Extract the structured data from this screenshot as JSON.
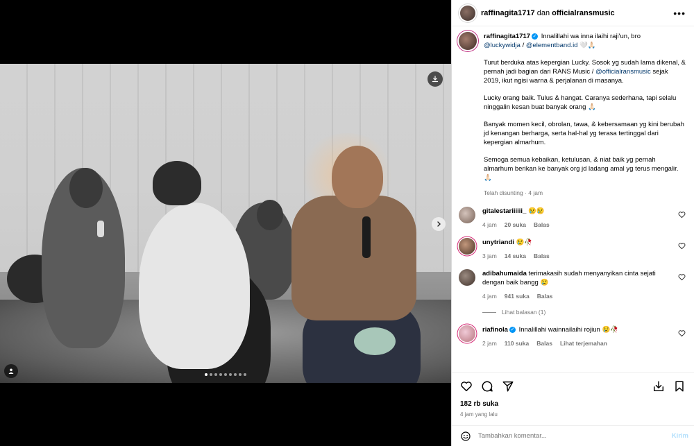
{
  "header": {
    "user1": "raffinagita1717",
    "conj": "dan",
    "user2": "officialransmusic",
    "more": "•••"
  },
  "caption": {
    "username": "raffinagita1717",
    "line1": "Innalillahi wa inna ilaihi raji'un, bro",
    "mention1": "@luckywidja",
    "sep": " / ",
    "mention2": "@elementband.id",
    "line1_end": " 🤍🙏🏻",
    "p1a": "Turut berduka atas kepergian Lucky. Sosok yg sudah lama dikenal, & pernah jadi bagian dari RANS Music /",
    "p1mention": "@officialransmusic",
    "p1b": " sejak 2019, ikut ngisi warna & perjalanan di masanya.",
    "p2": "Lucky orang baik. Tulus & hangat. Caranya sederhana, tapi selalu ninggalin kesan buat banyak orang 🙏🏻",
    "p3": "Banyak momen kecil, obrolan, tawa, & kebersamaan yg kini berubah jd kenangan berharga, serta hal-hal yg terasa tertinggal dari kepergian almarhum.",
    "p4": "Semoga semua kebaikan, ketulusan, & niat baik yg pernah almarhum berikan ke banyak org jd ladang amal yg terus mengalir. 🙏🏻",
    "meta": "Telah disunting · 4 jam"
  },
  "comments": [
    {
      "username": "gitalestariiiiii_",
      "text": "😢😢",
      "time": "4 jam",
      "likes": "20 suka",
      "reply": "Balas",
      "verified": false
    },
    {
      "username": "unytriandi",
      "text": "😢🥀",
      "time": "3 jam",
      "likes": "14 suka",
      "reply": "Balas",
      "verified": false
    },
    {
      "username": "adibahumaida",
      "text": "terimakasih sudah menyanyikan cinta sejati dengan baik bangg 😢",
      "time": "4 jam",
      "likes": "941 suka",
      "reply": "Balas",
      "verified": false
    },
    {
      "username": "riafinola",
      "text": "Innalillahi wainnailaihi rojiun 😢🥀",
      "time": "2 jam",
      "likes": "110 suka",
      "reply": "Balas",
      "translate": "Lihat terjemahan",
      "verified": true
    }
  ],
  "replies_link": "Lihat balasan (1)",
  "likes_count": "182 rb suka",
  "post_time": "4 jam yang lalu",
  "add_comment": {
    "placeholder": "Tambahkan komentar...",
    "post_label": "Kirim"
  },
  "carousel": {
    "count": 9,
    "active_index": 0
  },
  "icons": {
    "download": "download-icon",
    "next": "chevron-right-icon",
    "tag": "user-tag-icon",
    "like": "heart-icon",
    "comment": "comment-icon",
    "share": "send-icon",
    "save": "bookmark-icon",
    "emoji": "emoji-icon"
  },
  "colors": {
    "verified": "#0095f6",
    "mention": "#00376b",
    "post_disabled": "#b2dffc"
  }
}
